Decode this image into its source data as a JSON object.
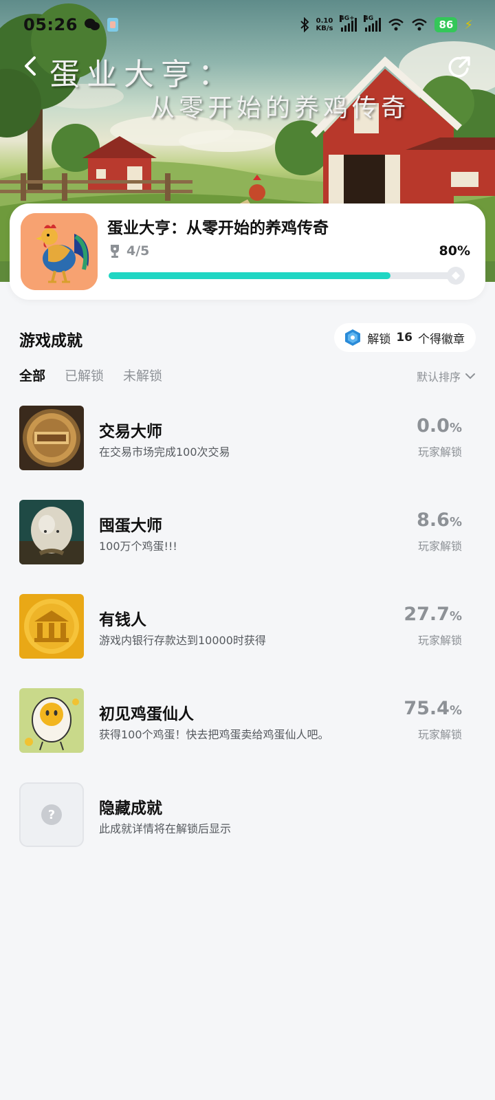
{
  "status": {
    "time": "05:26",
    "net_speed_value": "0.10",
    "net_speed_unit": "KB/s",
    "signal1_label": "4G+",
    "signal2_label": "4G",
    "battery": "86"
  },
  "banner": {
    "title": "蛋业大亨：",
    "subtitle": "从零开始的养鸡传奇"
  },
  "game": {
    "name": "蛋业大亨：从零开始的养鸡传奇",
    "trophy_count": "4/5",
    "progress_label": "80%",
    "progress_fraction": 0.8
  },
  "section": {
    "title": "游戏成就",
    "badge_prefix": "解锁",
    "badge_count": "16",
    "badge_suffix": "个得徽章"
  },
  "tabs": [
    {
      "label": "全部",
      "active": true
    },
    {
      "label": "已解锁",
      "active": false
    },
    {
      "label": "未解锁",
      "active": false
    }
  ],
  "sort": {
    "label": "默认排序"
  },
  "achievements": [
    {
      "name": "交易大师",
      "desc": "在交易市场完成100次交易",
      "pct": "0.0",
      "pct_unit": "%",
      "unlock_label": "玩家解锁",
      "icon": "gold-coin-trade-master-icon"
    },
    {
      "name": "囤蛋大师",
      "desc": "100万个鸡蛋!!!",
      "pct": "8.6",
      "pct_unit": "%",
      "unlock_label": "玩家解锁",
      "icon": "giant-egg-icon"
    },
    {
      "name": "有钱人",
      "desc": "游戏内银行存款达到10000时获得",
      "pct": "27.7",
      "pct_unit": "%",
      "unlock_label": "玩家解锁",
      "icon": "gold-bank-coin-icon"
    },
    {
      "name": "初见鸡蛋仙人",
      "desc": "获得100个鸡蛋！快去把鸡蛋卖给鸡蛋仙人吧。",
      "pct": "75.4",
      "pct_unit": "%",
      "unlock_label": "玩家解锁",
      "icon": "cartoon-egg-icon"
    }
  ],
  "hidden_achievement": {
    "name": "隐藏成就",
    "desc": "此成就详情将在解锁后显示",
    "icon": "question-mark-icon"
  },
  "colors": {
    "accent": "#1fd6c3",
    "background": "#f5f6f8",
    "muted_text": "#8d9196",
    "battery": "#34c759"
  }
}
